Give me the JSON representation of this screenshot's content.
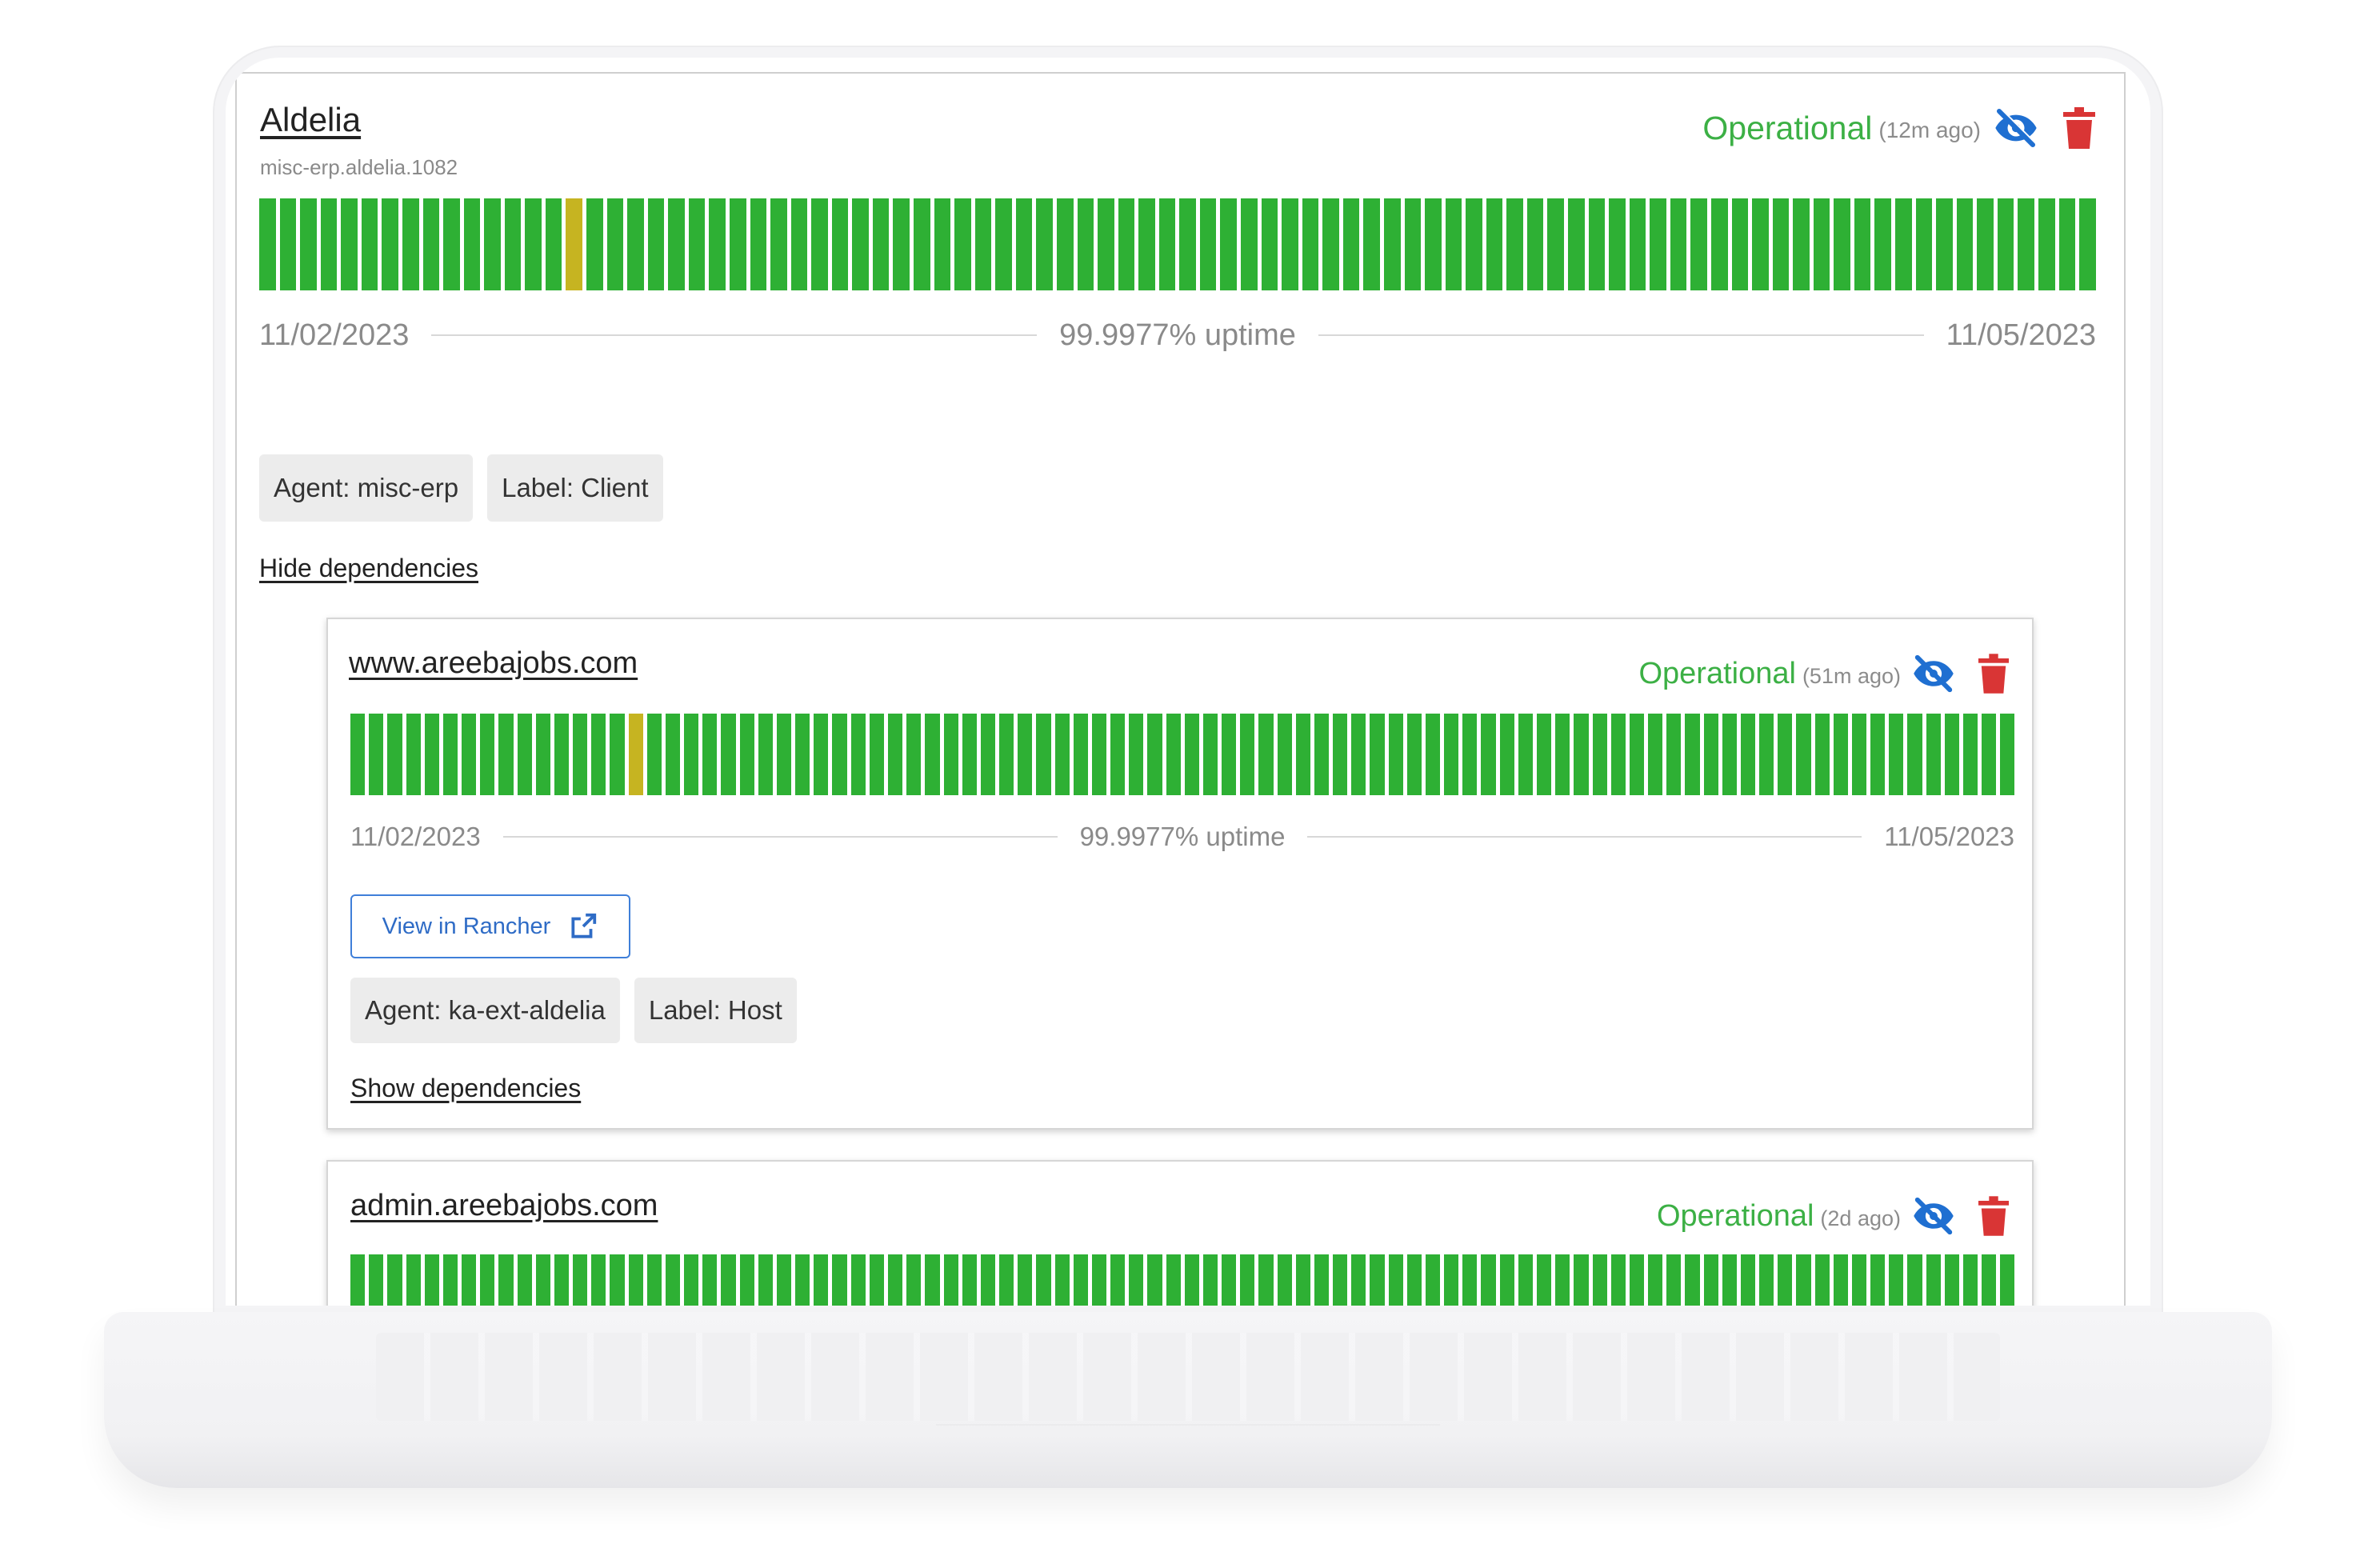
{
  "colors": {
    "operational": "#3cb045",
    "bar_ok": "#2eb034",
    "bar_warn": "#c6b421",
    "delete": "#d93535",
    "visibility": "#1f6fd1",
    "link_blue": "#2f6cc6"
  },
  "monitors": [
    {
      "title": "Aldelia",
      "subtitle": "misc-erp.aldelia.1082",
      "status": "Operational",
      "status_ago": "(12m ago)",
      "start_date": "11/02/2023",
      "end_date": "11/05/2023",
      "uptime_text": "99.9977% uptime",
      "uptime_percent": 99.9977,
      "bar_count": 90,
      "warn_bars": [
        15
      ],
      "chips": [
        "Agent: misc-erp",
        "Label: Client"
      ],
      "dependencies_link": "Hide dependencies",
      "icons": [
        "eye-off-icon",
        "trash-icon"
      ]
    },
    {
      "title": "www.areebajobs.com",
      "status": "Operational",
      "status_ago": "(51m ago)",
      "start_date": "11/02/2023",
      "end_date": "11/05/2023",
      "uptime_text": "99.9977% uptime",
      "uptime_percent": 99.9977,
      "bar_count": 90,
      "warn_bars": [
        15
      ],
      "action_button": "View in Rancher",
      "chips": [
        "Agent: ka-ext-aldelia",
        "Label: Host"
      ],
      "dependencies_link": "Show dependencies",
      "icons": [
        "eye-off-icon",
        "trash-icon",
        "external-link-icon"
      ]
    },
    {
      "title": "admin.areebajobs.com",
      "status": "Operational",
      "status_ago": "(2d ago)",
      "bar_count": 90,
      "warn_bars": [],
      "icons": [
        "eye-off-icon",
        "trash-icon"
      ]
    }
  ]
}
